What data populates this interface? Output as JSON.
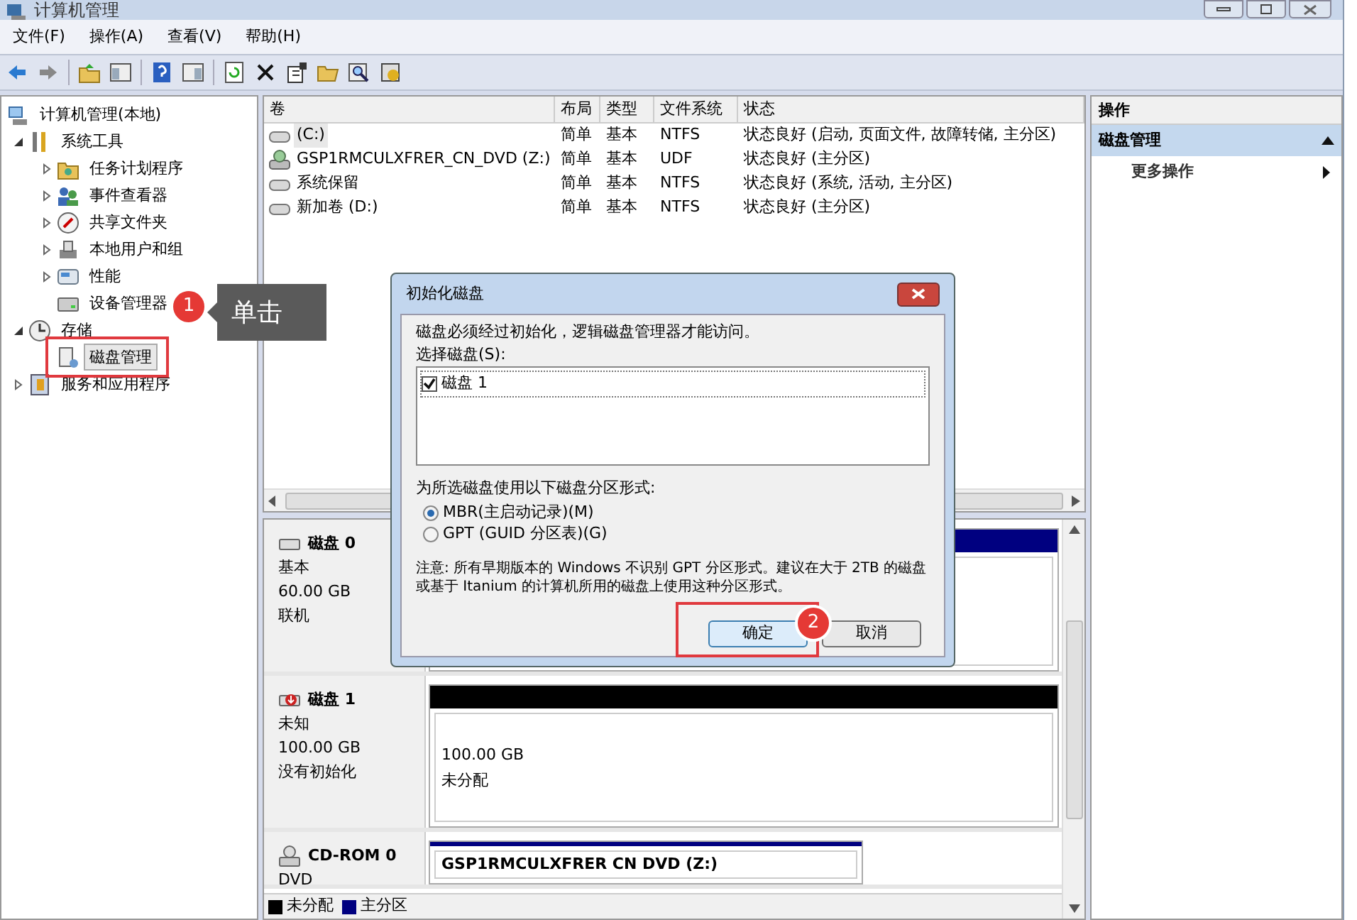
{
  "window": {
    "title": "计算机管理"
  },
  "menu": [
    "文件(F)",
    "操作(A)",
    "查看(V)",
    "帮助(H)"
  ],
  "tree": [
    {
      "label": "计算机管理(本地)",
      "selected": false,
      "children": [
        {
          "label": "系统工具",
          "expanded": true,
          "selected": false,
          "children": [
            {
              "label": "任务计划程序",
              "expanded": false,
              "selected": false
            },
            {
              "label": "事件查看器",
              "expanded": false,
              "selected": false
            },
            {
              "label": "共享文件夹",
              "expanded": false,
              "selected": false
            },
            {
              "label": "本地用户和组",
              "expanded": false,
              "selected": false
            },
            {
              "label": "性能",
              "expanded": false,
              "selected": false
            },
            {
              "label": "设备管理器",
              "selected": false
            }
          ]
        },
        {
          "label": "存储",
          "expanded": true,
          "selected": false,
          "children": [
            {
              "label": "磁盘管理",
              "selected": true
            }
          ]
        },
        {
          "label": "服务和应用程序",
          "expanded": false,
          "selected": false
        }
      ]
    }
  ],
  "volumes": {
    "columns": [
      "卷",
      "布局",
      "类型",
      "文件系统",
      "状态"
    ],
    "rows": [
      {
        "selected": true,
        "cells": [
          "(C:)",
          "简单",
          "基本",
          "NTFS",
          "状态良好 (启动, 页面文件, 故障转储, 主分区)"
        ]
      },
      {
        "selected": false,
        "kind": "optical",
        "cells": [
          "GSP1RMCULXFRER_CN_DVD (Z:)",
          "简单",
          "基本",
          "UDF",
          "状态良好 (主分区)"
        ]
      },
      {
        "selected": false,
        "cells": [
          "系统保留",
          "简单",
          "基本",
          "NTFS",
          "状态良好 (系统, 活动, 主分区)"
        ]
      },
      {
        "selected": false,
        "cells": [
          "新加卷 (D:)",
          "简单",
          "基本",
          "NTFS",
          "状态良好 (主分区)"
        ]
      }
    ]
  },
  "disks": [
    {
      "kind": "disk",
      "name": "磁盘 0",
      "details": [
        "基本",
        "60.00 GB",
        "联机"
      ],
      "partitions": [
        {
          "color": "#000080"
        }
      ]
    },
    {
      "kind": "uninitialized",
      "name": "磁盘 1",
      "details": [
        "未知",
        "100.00 GB",
        "没有初始化"
      ],
      "partitions": [
        {
          "color": "#000000",
          "size": "100.00 GB",
          "label": "未分配"
        }
      ]
    },
    {
      "kind": "cdrom",
      "name": "CD-ROM 0",
      "details": [
        "DVD"
      ],
      "partitions": [
        {
          "color": "#000080",
          "label": "GSP1RMCULXFRER CN DVD  (Z:)"
        }
      ]
    }
  ],
  "legend": [
    {
      "label": "未分配",
      "color": "#000000"
    },
    {
      "label": "主分区",
      "color": "#000080"
    }
  ],
  "actions": {
    "title": "操作",
    "section": "磁盘管理",
    "items": [
      "更多操作"
    ]
  },
  "dialog": {
    "title": "初始化磁盘",
    "message": "磁盘必须经过初始化，逻辑磁盘管理器才能访问。",
    "select_label": "选择磁盘(S):",
    "disks": [
      {
        "label": "磁盘 1",
        "checked": true
      }
    ],
    "style_label": "为所选磁盘使用以下磁盘分区形式:",
    "options": [
      {
        "label": "MBR(主启动记录)(M)",
        "selected": true
      },
      {
        "label": "GPT (GUID 分区表)(G)",
        "selected": false
      }
    ],
    "note": "注意: 所有早期版本的 Windows 不识别 GPT 分区形式。建议在大于 2TB 的磁盘或基于 Itanium 的计算机所用的磁盘上使用这种分区形式。",
    "buttons": [
      {
        "label": "确定",
        "default": true
      },
      {
        "label": "取消",
        "default": false
      }
    ]
  },
  "steps": [
    {
      "number": "1",
      "callout": "单击"
    },
    {
      "number": "2"
    }
  ]
}
